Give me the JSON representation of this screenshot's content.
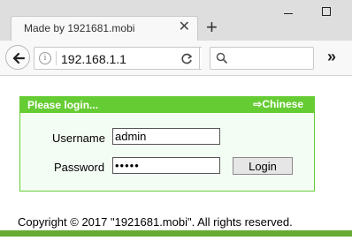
{
  "browser": {
    "tab_title": "Made by 1921681.mobi",
    "url": "192.168.1.1",
    "search_placeholder": ""
  },
  "panel": {
    "title": "Please login...",
    "language_link": "Chinese",
    "username_label": "Username",
    "username_value": "admin",
    "password_label": "Password",
    "password_value": "•••••",
    "login_button": "Login"
  },
  "footer": {
    "copyright": "Copyright © 2017 \"1921681.mobi\". All rights reserved."
  },
  "colors": {
    "accent_green": "#66cc33",
    "footer_green": "#66aa33"
  }
}
